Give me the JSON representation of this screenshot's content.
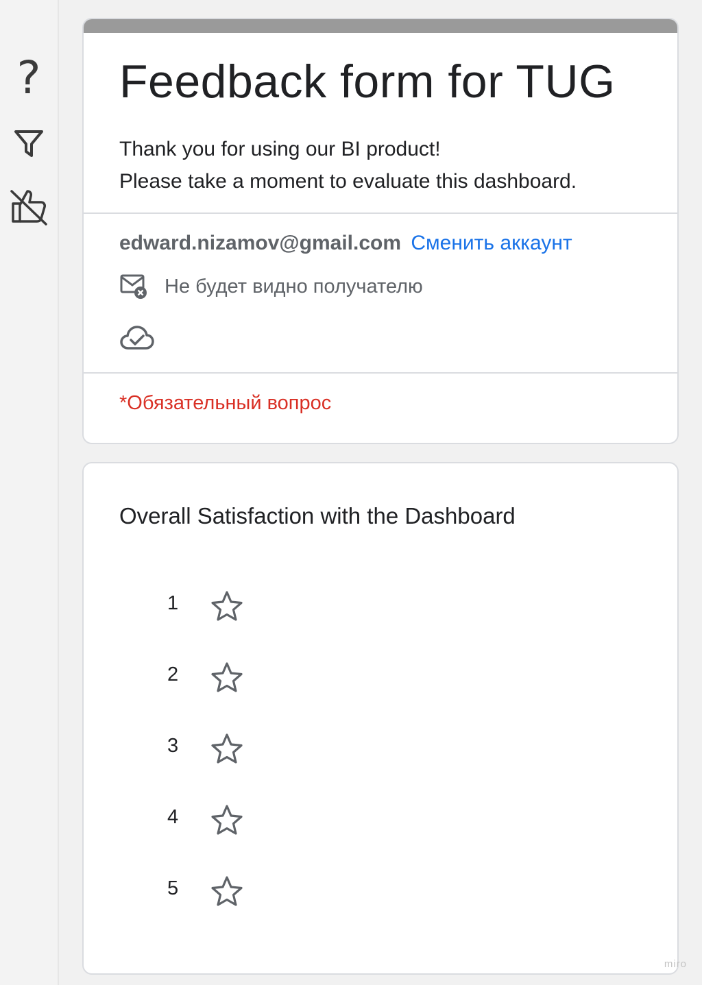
{
  "sidebar": {
    "help_label": "?",
    "icons": [
      "help-icon",
      "filter-icon",
      "dislike-icon"
    ]
  },
  "form": {
    "title": "Feedback form for TUG",
    "description_line1": "Thank you for using our BI product!",
    "description_line2": "Please take a moment to evaluate this dashboard.",
    "account_email": "edward.nizamov@gmail.com",
    "switch_account_label": "Сменить аккаунт",
    "hidden_from_recipient": "Не будет видно получателю",
    "required_note": "*Обязательный вопрос"
  },
  "question": {
    "title": "Overall Satisfaction with the Dashboard",
    "options": [
      {
        "label": "1"
      },
      {
        "label": "2"
      },
      {
        "label": "3"
      },
      {
        "label": "4"
      },
      {
        "label": "5"
      }
    ]
  },
  "watermark": "miro",
  "colors": {
    "accent_link": "#1a73e8",
    "required": "#d93025",
    "header_bar": "#9a9a9a"
  }
}
